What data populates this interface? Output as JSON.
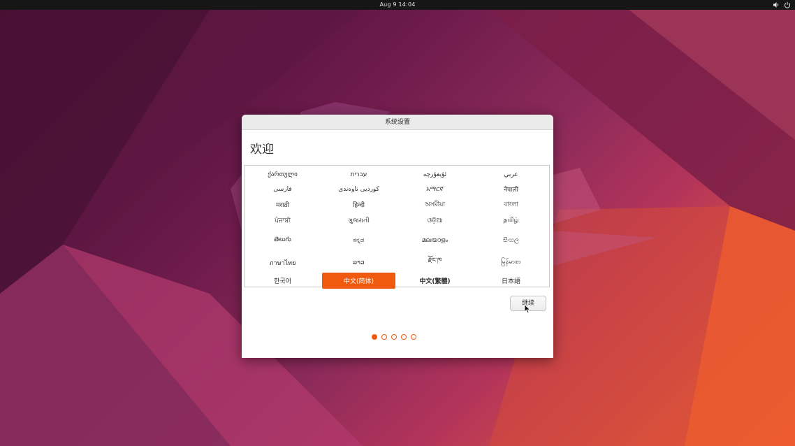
{
  "topbar": {
    "clock": "Aug 9  14:04",
    "icons": [
      "volume-icon",
      "power-icon"
    ]
  },
  "dialog": {
    "title": "系统设置",
    "heading": "欢迎",
    "languages": [
      "ქართული",
      "עברית",
      "ئۇيغۇرچە",
      "عربي",
      "فارسی",
      "کوردیی ناوەندی",
      "አማርኛ",
      "नेपाली",
      "मराठी",
      "हिन्दी",
      "অসমীয়া",
      "বাংলা",
      "ਪੰਜਾਬੀ",
      "ગુજરાતી",
      "ଓଡ଼ିଆ",
      "தமிழ்",
      "తెలుగు",
      "ಕನ್ನಡ",
      "മലയാളം",
      "සිංහල",
      "ภาษาไทย",
      "ລາວ",
      "རྫོང་ཁ",
      "မြန်မာစာ",
      "한국어",
      "中文(简体)",
      "中文(繁體)",
      "日本語"
    ],
    "selected_language": "中文(简体)",
    "continue_label": "继续",
    "pager": {
      "total": 5,
      "current": 1
    }
  },
  "colors": {
    "accent": "#f05a0e",
    "topbar": "#161616"
  }
}
